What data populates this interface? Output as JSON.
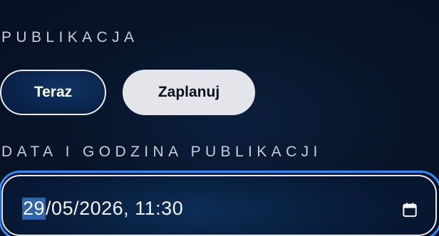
{
  "publication": {
    "section_label": "PUBLIKACJA",
    "options": [
      {
        "label": "Teraz",
        "selected": false
      },
      {
        "label": "Zaplanuj",
        "selected": true
      }
    ]
  },
  "datetime": {
    "section_label": "DATA I GODZINA PUBLIKACJI",
    "day": "29",
    "rest": "/05/2026, 11:30",
    "icon": "calendar-icon"
  },
  "colors": {
    "focus_ring": "#2f8cff",
    "selected_pill_bg": "#e4e5ea",
    "background": "#060d1f",
    "segment_highlight": "#2f66a8"
  }
}
